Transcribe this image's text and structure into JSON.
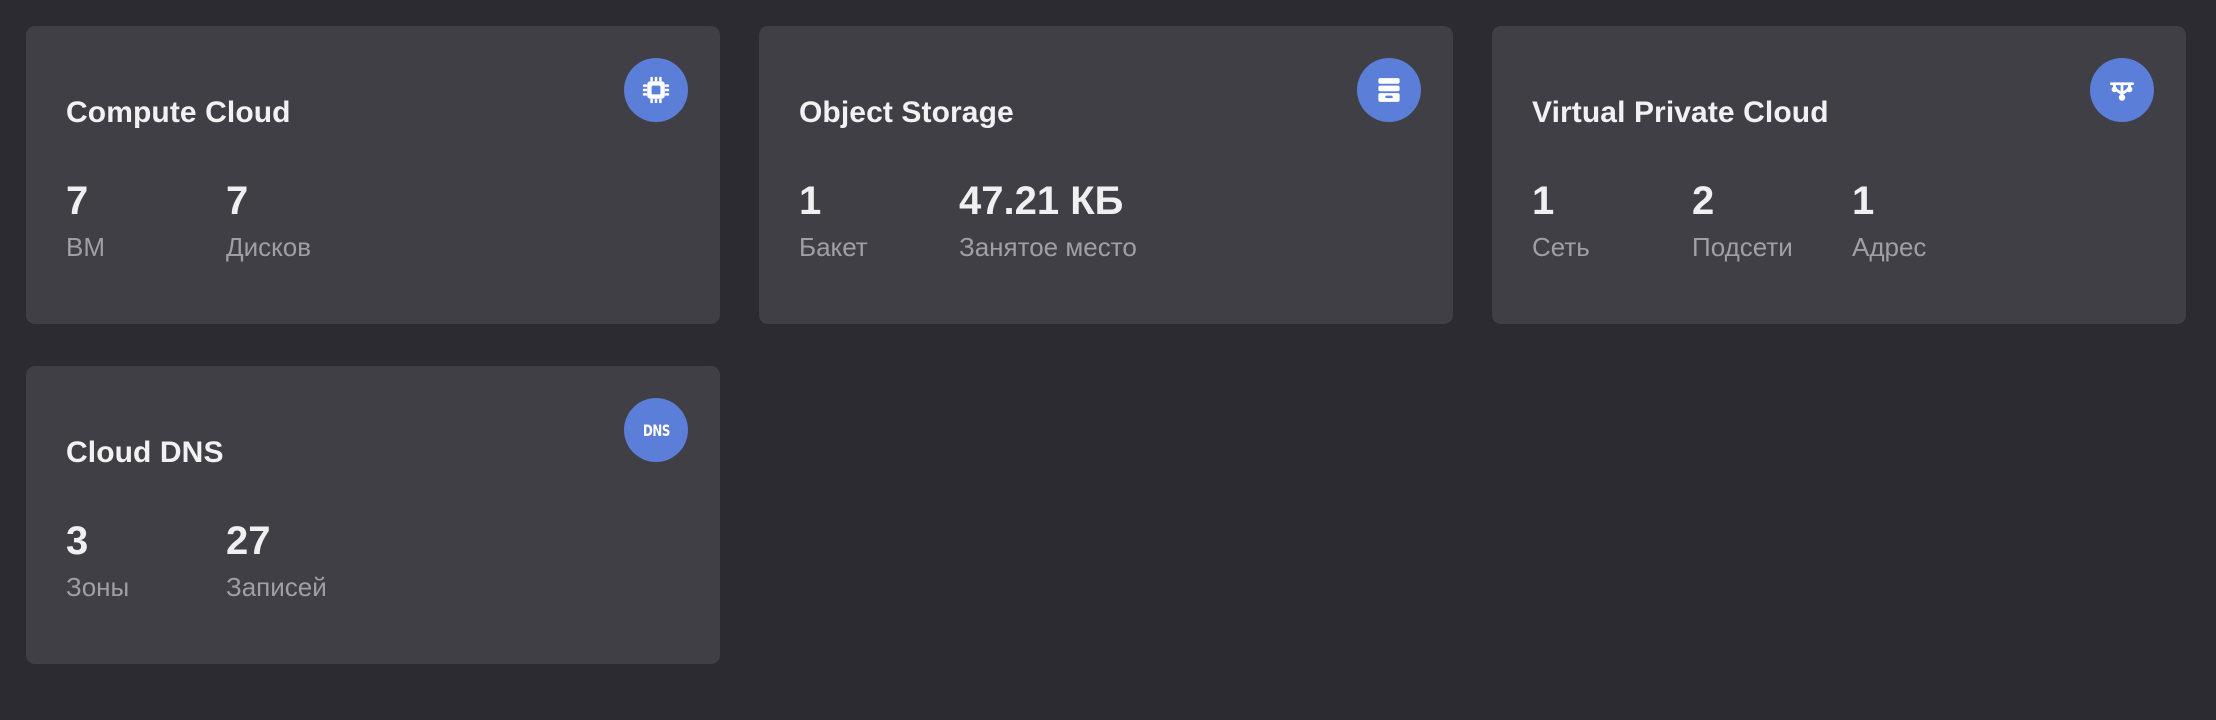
{
  "cards": [
    {
      "title": "Compute Cloud",
      "icon": "chip-icon",
      "stats": [
        {
          "value": "7",
          "label": "ВМ"
        },
        {
          "value": "7",
          "label": "Дисков"
        }
      ]
    },
    {
      "title": "Object Storage",
      "icon": "storage-box-icon",
      "stats": [
        {
          "value": "1",
          "label": "Бакет"
        },
        {
          "value": "47.21 КБ",
          "label": "Занятое место"
        }
      ]
    },
    {
      "title": "Virtual Private Cloud",
      "icon": "network-icon",
      "stats": [
        {
          "value": "1",
          "label": "Сеть"
        },
        {
          "value": "2",
          "label": "Подсети"
        },
        {
          "value": "1",
          "label": "Адрес"
        }
      ]
    },
    {
      "title": "Cloud DNS",
      "icon": "dns-icon",
      "icon_text": "DNS",
      "stats": [
        {
          "value": "3",
          "label": "Зоны"
        },
        {
          "value": "27",
          "label": "Записей"
        }
      ]
    }
  ],
  "colors": {
    "background": "#2c2b31",
    "card": "#403f45",
    "accent": "#5b7ed8",
    "text_primary": "#f0f0f0",
    "text_secondary": "#a09fa5"
  }
}
